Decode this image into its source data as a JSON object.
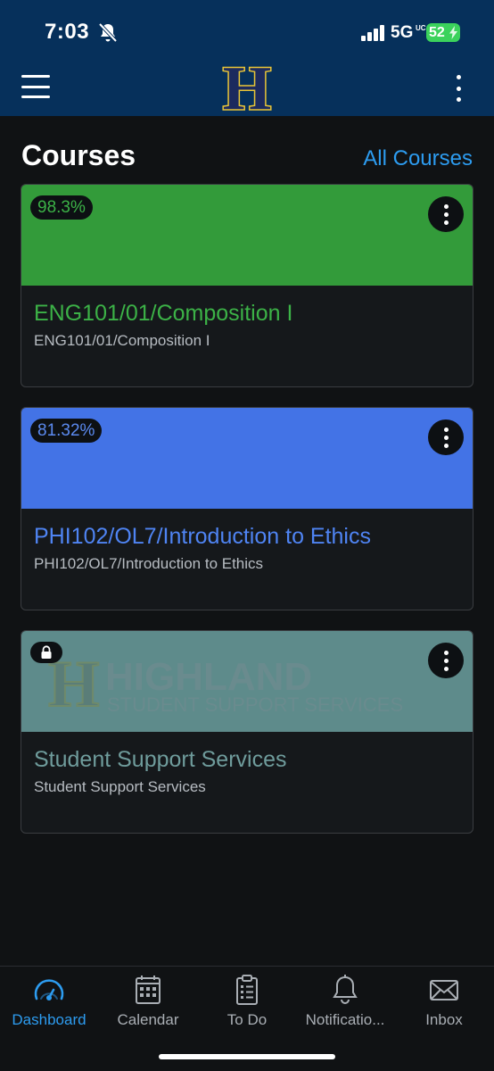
{
  "status_bar": {
    "time": "7:03",
    "network": "5G",
    "network_suffix": "UC",
    "battery": "52"
  },
  "app_bar": {
    "logo_letter": "H"
  },
  "section": {
    "title": "Courses",
    "all_courses_link": "All Courses"
  },
  "courses": [
    {
      "grade": "98.3%",
      "title": "ENG101/01/Composition I",
      "subtitle": "ENG101/01/Composition I",
      "color": "#339b3a"
    },
    {
      "grade": "81.32%",
      "title": "PHI102/OL7/Introduction to Ethics",
      "subtitle": "PHI102/OL7/Introduction to Ethics",
      "color": "#4373e6"
    },
    {
      "title": "Student Support Services",
      "subtitle": "Student Support Services",
      "color": "#5e8b8b",
      "watermark_title": "HIGHLAND",
      "watermark_subtitle": "STUDENT SUPPORT SERVICES",
      "locked": true
    }
  ],
  "bottom_nav": [
    {
      "label": "Dashboard",
      "icon": "dashboard-gauge-icon",
      "active": true
    },
    {
      "label": "Calendar",
      "icon": "calendar-icon",
      "active": false
    },
    {
      "label": "To Do",
      "icon": "clipboard-icon",
      "active": false
    },
    {
      "label": "Notificatio...",
      "icon": "bell-icon",
      "active": false
    },
    {
      "label": "Inbox",
      "icon": "envelope-icon",
      "active": false
    }
  ],
  "colors": {
    "header_bg": "#06305b",
    "page_bg": "#101214",
    "accent": "#2d9cf0",
    "logo_gold": "#e8c437",
    "logo_navy": "#1c2a5e"
  }
}
